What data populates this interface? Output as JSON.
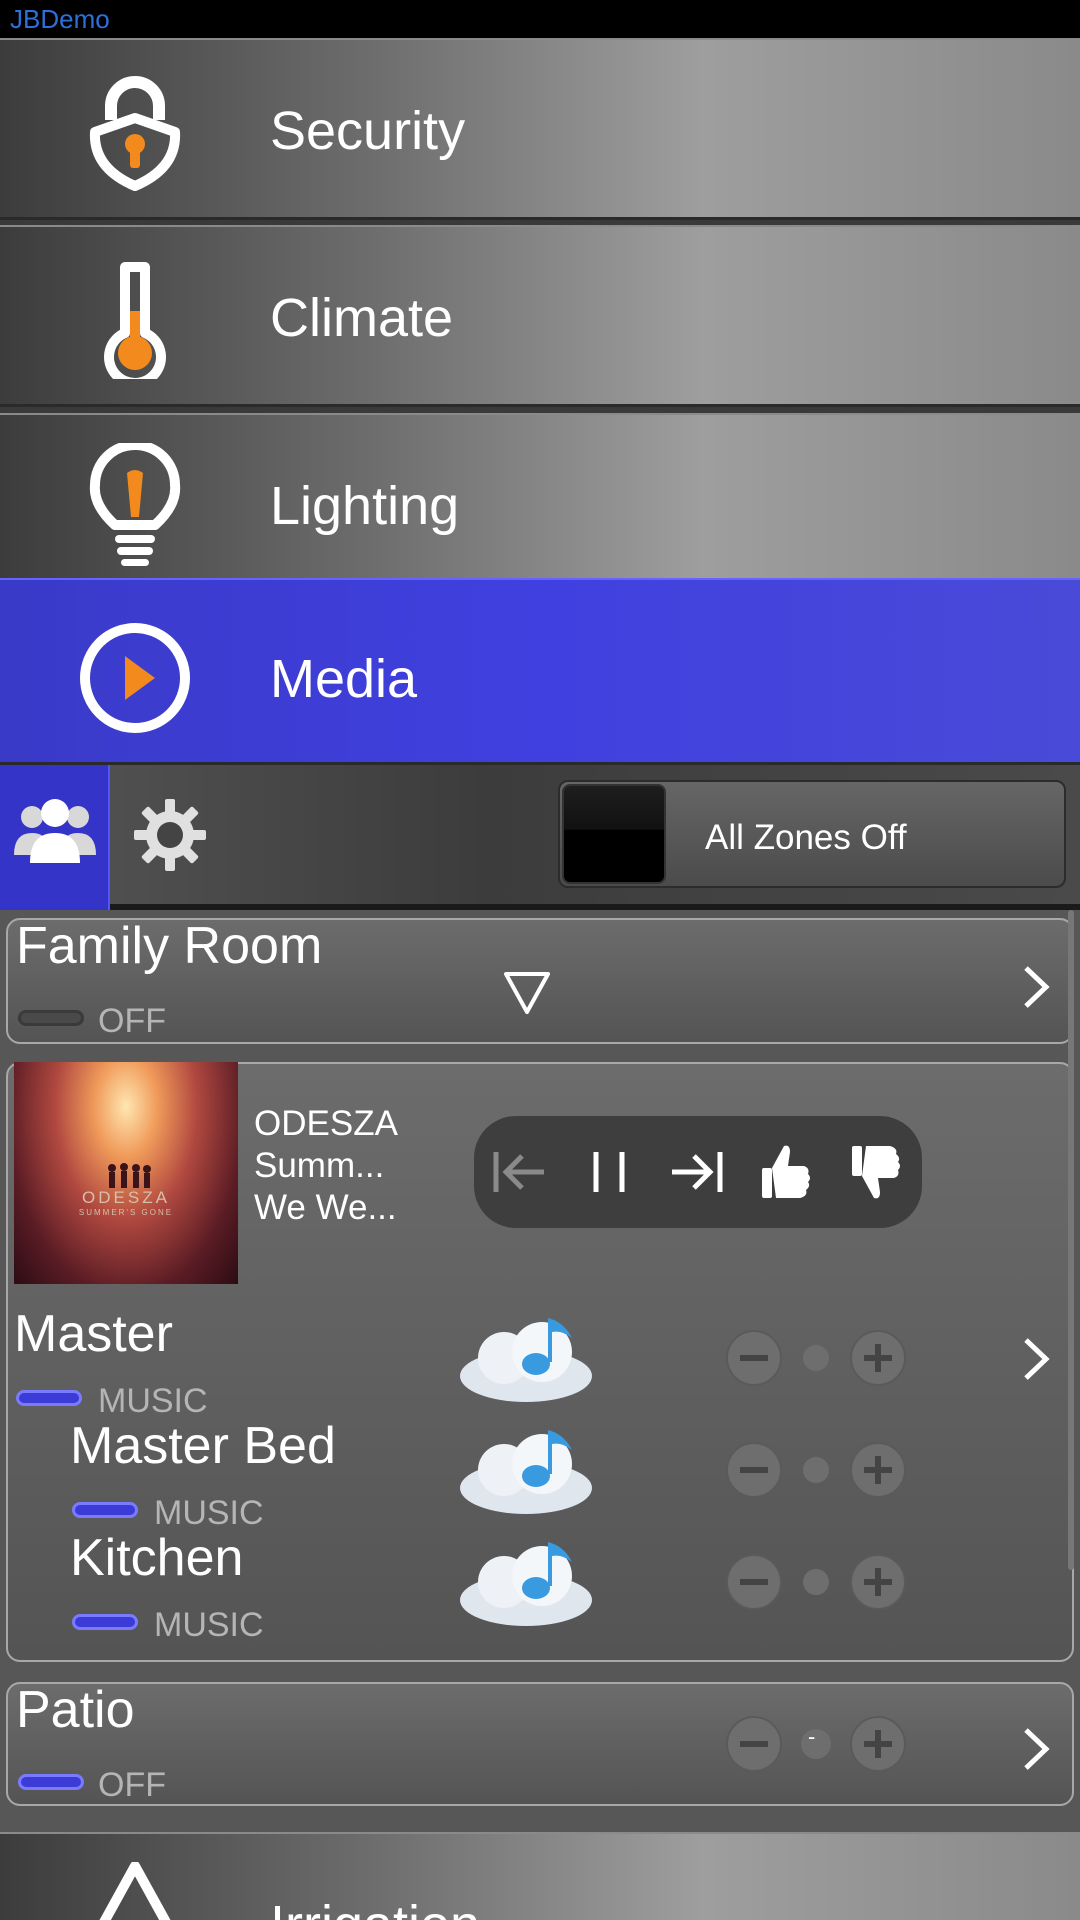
{
  "app": {
    "title": "JBDemo"
  },
  "nav": {
    "items": [
      {
        "label": "Security",
        "icon": "lock-icon"
      },
      {
        "label": "Climate",
        "icon": "thermometer-icon"
      },
      {
        "label": "Lighting",
        "icon": "lightbulb-icon"
      },
      {
        "label": "Media",
        "icon": "play-icon",
        "active": true
      },
      {
        "label": "Irrigation",
        "icon": "water-drop-icon"
      }
    ]
  },
  "toolbar": {
    "group_icon": "users-icon",
    "settings_icon": "gear-icon",
    "all_zones_label": "All Zones Off"
  },
  "zones": {
    "family_room": {
      "name": "Family Room",
      "status": "OFF"
    },
    "now_playing": {
      "album_art_text": "ODESZA",
      "album_art_subtext": "SUMMER'S GONE",
      "artist": "ODESZA",
      "album": "Summ...",
      "track": "We We..."
    },
    "master": {
      "name": "Master",
      "status": "MUSIC"
    },
    "master_bed": {
      "name": "Master Bed",
      "status": "MUSIC"
    },
    "kitchen": {
      "name": "Kitchen",
      "status": "MUSIC"
    },
    "patio": {
      "name": "Patio",
      "status": "OFF",
      "volume": "-"
    }
  },
  "colors": {
    "accent": "#3f3fdc",
    "icon_orange": "#f28a1e",
    "title_text": "#2f6fd8"
  }
}
